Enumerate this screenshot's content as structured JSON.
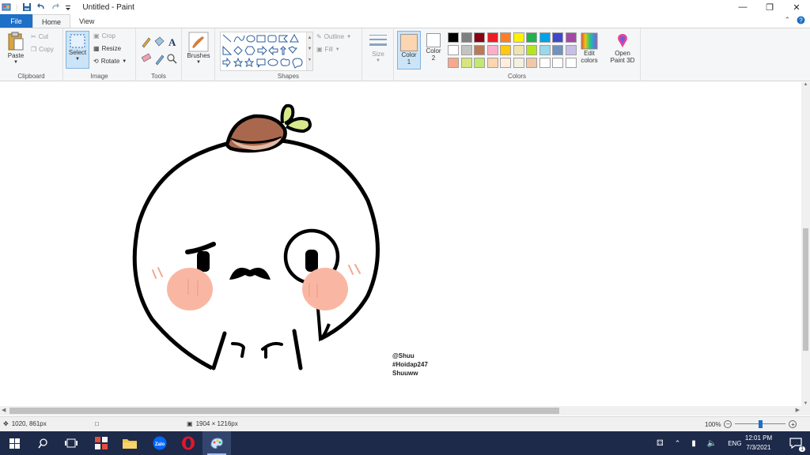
{
  "window": {
    "title": "Untitled - Paint",
    "controls": [
      "minimize-icon",
      "restore-icon",
      "close-icon"
    ]
  },
  "ribbon_tabs": {
    "file": "File",
    "home": "Home",
    "view": "View"
  },
  "clipboard": {
    "paste": "Paste",
    "cut": "Cut",
    "copy": "Copy",
    "label": "Clipboard"
  },
  "image": {
    "select": "Select",
    "crop": "Crop",
    "resize": "Resize",
    "rotate": "Rotate",
    "label": "Image"
  },
  "tools": {
    "label": "Tools"
  },
  "brushes": {
    "label": "Brushes"
  },
  "shapes": {
    "outline": "Outline",
    "fill": "Fill",
    "label": "Shapes"
  },
  "size": {
    "label": "Size"
  },
  "colors": {
    "color1": "Color\n1",
    "color1_line1": "Color",
    "color1_line2": "1",
    "color2_line1": "Color",
    "color2_line2": "2",
    "color1_value": "#fdd5b1",
    "color2_value": "#ffffff",
    "edit_line1": "Edit",
    "edit_line2": "colors",
    "label": "Colors",
    "palette_row1": [
      "#000000",
      "#7f7f7f",
      "#880015",
      "#ed1c24",
      "#ff7f27",
      "#fff200",
      "#22b14c",
      "#00a2e8",
      "#3f48cc",
      "#a349a4"
    ],
    "palette_row2": [
      "#ffffff",
      "#c3c3c3",
      "#b97a57",
      "#ffaec9",
      "#ffc90e",
      "#efe4b0",
      "#b5e61d",
      "#99d9ea",
      "#7092be",
      "#c8bfe7"
    ],
    "palette_row3": [
      "#f9a98b",
      "#d6e57d",
      "#c2e86f",
      "#fdd5b1",
      "#ffeedd",
      "#f5f0e0",
      "#f0c8a8",
      "#ffffff",
      "#ffffff",
      "#ffffff"
    ]
  },
  "paint3d": {
    "line1": "Open",
    "line2": "Paint 3D"
  },
  "canvas": {
    "watermark_lines": [
      "@Shuu",
      "#Hoidap247",
      "Shuuww"
    ]
  },
  "status": {
    "cursor_pos": "1020, 861px",
    "image_size": "1904 × 1216px",
    "zoom": "100%"
  },
  "taskbar": {
    "time": "12:01 PM",
    "date": "7/3/2021",
    "lang": "ENG",
    "notification_count": "1"
  }
}
